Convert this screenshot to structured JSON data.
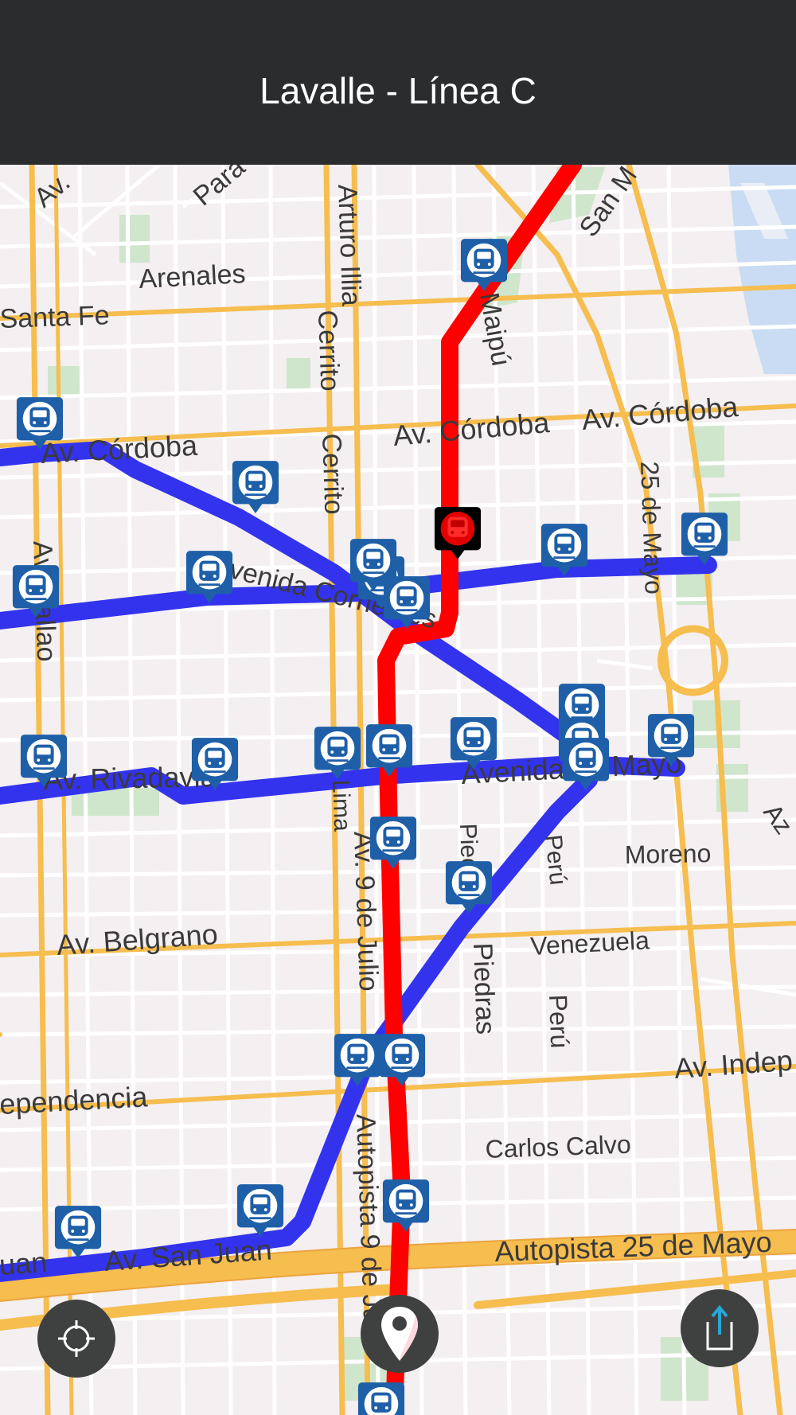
{
  "header": {
    "title": "Lavalle - Línea C"
  },
  "map": {
    "streets": [
      {
        "id": "av-top-left",
        "text": "Av."
      },
      {
        "id": "para",
        "text": "Para"
      },
      {
        "id": "arturo-illia",
        "text": "Arturo Illia"
      },
      {
        "id": "san-martin",
        "text": "San M"
      },
      {
        "id": "arenales",
        "text": "Arenales"
      },
      {
        "id": "santa-fe",
        "text": "Santa Fe"
      },
      {
        "id": "cerrito-1",
        "text": "Cerrito"
      },
      {
        "id": "maipu",
        "text": "Maipú"
      },
      {
        "id": "cordoba-1",
        "text": "Av. Córdoba"
      },
      {
        "id": "cordoba-2",
        "text": "Av. Córdoba"
      },
      {
        "id": "cordoba-3",
        "text": "Av. Córdoba"
      },
      {
        "id": "cerrito-2",
        "text": "Cerrito"
      },
      {
        "id": "25-de-mayo",
        "text": "25 de Mayo"
      },
      {
        "id": "callao",
        "text": "Av. Callao"
      },
      {
        "id": "corrientes",
        "text": "Avenida Corrientes"
      },
      {
        "id": "rivadavia",
        "text": "Av. Rivadavia"
      },
      {
        "id": "lima",
        "text": "Lima"
      },
      {
        "id": "avenida-de-mayo",
        "text": "Avenida de Mayo"
      },
      {
        "id": "az",
        "text": "Az"
      },
      {
        "id": "9-de-julio",
        "text": "Av. 9 de Julio"
      },
      {
        "id": "piedras-1",
        "text": "Piedras"
      },
      {
        "id": "peru-1",
        "text": "Perú"
      },
      {
        "id": "moreno",
        "text": "Moreno"
      },
      {
        "id": "belgrano",
        "text": "Av. Belgrano"
      },
      {
        "id": "venezuela",
        "text": "Venezuela"
      },
      {
        "id": "piedras-2",
        "text": "Piedras"
      },
      {
        "id": "peru-2",
        "text": "Perú"
      },
      {
        "id": "independencia-1",
        "text": "Av. Indep"
      },
      {
        "id": "independencia-2",
        "text": "ependencia"
      },
      {
        "id": "autopista-9",
        "text": "Autopista 9 de Julio"
      },
      {
        "id": "carlos-calvo",
        "text": "Carlos Calvo"
      },
      {
        "id": "san-juan",
        "text": "Av. San Juan"
      },
      {
        "id": "juan-left",
        "text": "uan"
      },
      {
        "id": "autopista-25",
        "text": "Autopista 25 de Mayo"
      }
    ],
    "lines": [
      {
        "name": "Línea C",
        "color": "#ff0000"
      },
      {
        "name": "blue-lines",
        "color": "#3333ee"
      }
    ],
    "station_marker": {
      "icon": "subway-train-icon",
      "color": "#1e5fa8"
    },
    "selected_station": {
      "icon": "subway-train-icon",
      "color": "#cc0000"
    }
  },
  "controls": {
    "locate": {
      "icon": "crosshair-icon"
    },
    "pin": {
      "icon": "map-pin-icon"
    },
    "share": {
      "icon": "share-icon",
      "accent": "#2aa7d6"
    }
  }
}
